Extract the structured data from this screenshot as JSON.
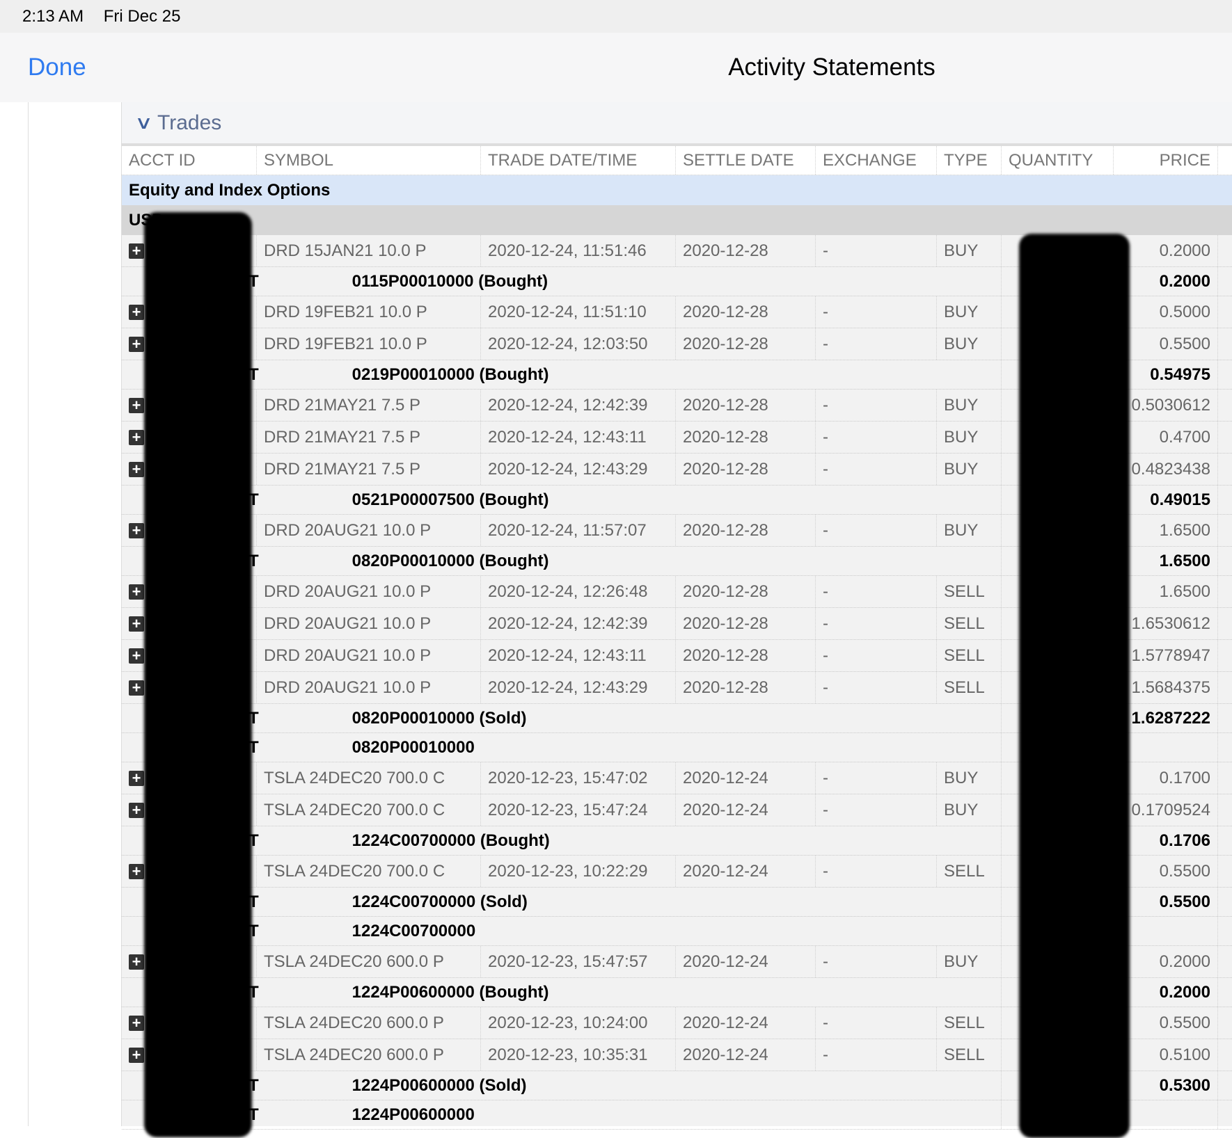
{
  "status_bar": {
    "time": "2:13 AM",
    "date": "Fri Dec 25"
  },
  "nav": {
    "done": "Done",
    "title": "Activity Statements"
  },
  "section": {
    "title": "Trades"
  },
  "columns": [
    "ACCT ID",
    "SYMBOL",
    "TRADE DATE/TIME",
    "SETTLE DATE",
    "EXCHANGE",
    "TYPE",
    "QUANTITY",
    "PRICE"
  ],
  "group": "Equity and Index Options",
  "currency": "USD",
  "rows": [
    {
      "kind": "trade",
      "symbol": "DRD 15JAN21 10.0 P",
      "datetime": "2020-12-24, 11:51:46",
      "settle": "2020-12-28",
      "exchange": "-",
      "type": "BUY",
      "price": "0.2000"
    },
    {
      "kind": "sum",
      "label": "0115P00010000 (Bought)",
      "price": "0.2000"
    },
    {
      "kind": "trade",
      "symbol": "DRD 19FEB21 10.0 P",
      "datetime": "2020-12-24, 11:51:10",
      "settle": "2020-12-28",
      "exchange": "-",
      "type": "BUY",
      "price": "0.5000"
    },
    {
      "kind": "trade",
      "symbol": "DRD 19FEB21 10.0 P",
      "datetime": "2020-12-24, 12:03:50",
      "settle": "2020-12-28",
      "exchange": "-",
      "type": "BUY",
      "price": "0.5500"
    },
    {
      "kind": "sum",
      "label": "0219P00010000 (Bought)",
      "price": "0.54975"
    },
    {
      "kind": "trade",
      "symbol": "DRD 21MAY21 7.5 P",
      "datetime": "2020-12-24, 12:42:39",
      "settle": "2020-12-28",
      "exchange": "-",
      "type": "BUY",
      "price": "0.5030612"
    },
    {
      "kind": "trade",
      "symbol": "DRD 21MAY21 7.5 P",
      "datetime": "2020-12-24, 12:43:11",
      "settle": "2020-12-28",
      "exchange": "-",
      "type": "BUY",
      "price": "0.4700"
    },
    {
      "kind": "trade",
      "symbol": "DRD 21MAY21 7.5 P",
      "datetime": "2020-12-24, 12:43:29",
      "settle": "2020-12-28",
      "exchange": "-",
      "type": "BUY",
      "price": "0.4823438"
    },
    {
      "kind": "sum",
      "label": "0521P00007500 (Bought)",
      "price": "0.49015"
    },
    {
      "kind": "trade",
      "symbol": "DRD 20AUG21 10.0 P",
      "datetime": "2020-12-24, 11:57:07",
      "settle": "2020-12-28",
      "exchange": "-",
      "type": "BUY",
      "price": "1.6500"
    },
    {
      "kind": "sum",
      "label": "0820P00010000 (Bought)",
      "price": "1.6500"
    },
    {
      "kind": "trade",
      "symbol": "DRD 20AUG21 10.0 P",
      "datetime": "2020-12-24, 12:26:48",
      "settle": "2020-12-28",
      "exchange": "-",
      "type": "SELL",
      "price": "1.6500"
    },
    {
      "kind": "trade",
      "symbol": "DRD 20AUG21 10.0 P",
      "datetime": "2020-12-24, 12:42:39",
      "settle": "2020-12-28",
      "exchange": "-",
      "type": "SELL",
      "price": "1.6530612"
    },
    {
      "kind": "trade",
      "symbol": "DRD 20AUG21 10.0 P",
      "datetime": "2020-12-24, 12:43:11",
      "settle": "2020-12-28",
      "exchange": "-",
      "type": "SELL",
      "price": "1.5778947"
    },
    {
      "kind": "trade",
      "symbol": "DRD 20AUG21 10.0 P",
      "datetime": "2020-12-24, 12:43:29",
      "settle": "2020-12-28",
      "exchange": "-",
      "type": "SELL",
      "price": "1.5684375"
    },
    {
      "kind": "sum",
      "label": "0820P00010000 (Sold)",
      "price": "1.6287222"
    },
    {
      "kind": "sum",
      "label": "0820P00010000",
      "price": ""
    },
    {
      "kind": "trade",
      "symbol": "TSLA 24DEC20 700.0 C",
      "datetime": "2020-12-23, 15:47:02",
      "settle": "2020-12-24",
      "exchange": "-",
      "type": "BUY",
      "price": "0.1700"
    },
    {
      "kind": "trade",
      "symbol": "TSLA 24DEC20 700.0 C",
      "datetime": "2020-12-23, 15:47:24",
      "settle": "2020-12-24",
      "exchange": "-",
      "type": "BUY",
      "price": "0.1709524"
    },
    {
      "kind": "sum",
      "label": "1224C00700000 (Bought)",
      "price": "0.1706"
    },
    {
      "kind": "trade",
      "symbol": "TSLA 24DEC20 700.0 C",
      "datetime": "2020-12-23, 10:22:29",
      "settle": "2020-12-24",
      "exchange": "-",
      "type": "SELL",
      "price": "0.5500"
    },
    {
      "kind": "sum",
      "label": "1224C00700000 (Sold)",
      "price": "0.5500"
    },
    {
      "kind": "sum",
      "label": "1224C00700000",
      "price": ""
    },
    {
      "kind": "trade",
      "symbol": "TSLA 24DEC20 600.0 P",
      "datetime": "2020-12-23, 15:47:57",
      "settle": "2020-12-24",
      "exchange": "-",
      "type": "BUY",
      "price": "0.2000"
    },
    {
      "kind": "sum",
      "label": "1224P00600000 (Bought)",
      "price": "0.2000"
    },
    {
      "kind": "trade",
      "symbol": "TSLA 24DEC20 600.0 P",
      "datetime": "2020-12-23, 10:24:00",
      "settle": "2020-12-24",
      "exchange": "-",
      "type": "SELL",
      "price": "0.5500"
    },
    {
      "kind": "trade",
      "symbol": "TSLA 24DEC20 600.0 P",
      "datetime": "2020-12-23, 10:35:31",
      "settle": "2020-12-24",
      "exchange": "-",
      "type": "SELL",
      "price": "0.5100"
    },
    {
      "kind": "sum",
      "label": "1224P00600000 (Sold)",
      "price": "0.5300"
    },
    {
      "kind": "sum",
      "label": "1224P00600000",
      "price": ""
    }
  ]
}
